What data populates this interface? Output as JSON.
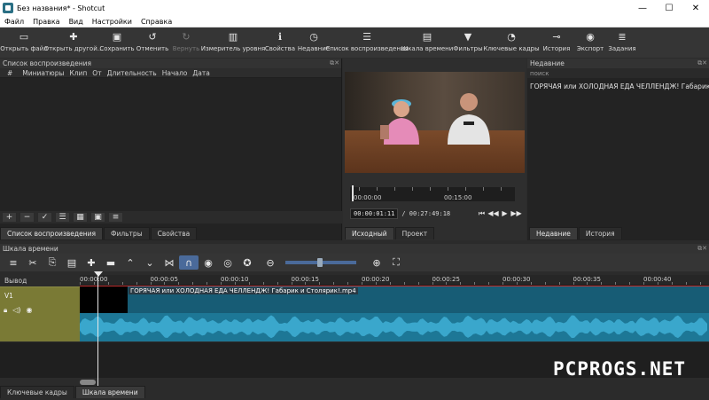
{
  "window": {
    "title": "Без названия* - Shotcut",
    "minimize": "—",
    "maximize": "☐",
    "close": "✕"
  },
  "menu": [
    "Файл",
    "Правка",
    "Вид",
    "Настройки",
    "Справка"
  ],
  "toolbar": [
    {
      "label": "Открыть файл",
      "icon": "folder-icon",
      "glyph": "▭"
    },
    {
      "label": "Открыть другой...",
      "icon": "open-other-icon",
      "glyph": "✚"
    },
    {
      "label": "Сохранить",
      "icon": "save-icon",
      "glyph": "▣"
    },
    {
      "label": "Отменить",
      "icon": "undo-icon",
      "glyph": "↺"
    },
    {
      "label": "Вернуть",
      "icon": "redo-icon",
      "glyph": "↻",
      "disabled": true
    },
    {
      "label": "Измеритель уровня",
      "icon": "level-meter-icon",
      "glyph": "▥"
    },
    {
      "label": "Свойства",
      "icon": "info-icon",
      "glyph": "ℹ"
    },
    {
      "label": "Недавние",
      "icon": "clock-icon",
      "glyph": "◷"
    },
    {
      "label": "Список воспроизведения",
      "icon": "playlist-icon",
      "glyph": "☰"
    },
    {
      "label": "Шкала времени",
      "icon": "timeline-icon",
      "glyph": "▤"
    },
    {
      "label": "Фильтры",
      "icon": "filter-icon",
      "glyph": "▼"
    },
    {
      "label": "Ключевые кадры",
      "icon": "stopwatch-icon",
      "glyph": "◔"
    },
    {
      "label": "История",
      "icon": "history-icon",
      "glyph": "⊸"
    },
    {
      "label": "Экспорт",
      "icon": "export-disc-icon",
      "glyph": "◉"
    },
    {
      "label": "Задания",
      "icon": "jobs-icon",
      "glyph": "≣"
    }
  ],
  "playlist": {
    "title": "Список воспроизведения",
    "columns": [
      "#",
      "Миниатюры",
      "Клип",
      "От",
      "Длительность",
      "Начало",
      "Дата"
    ],
    "tabs": [
      "Список воспроизведения",
      "Фильтры",
      "Свойства"
    ]
  },
  "player": {
    "ruler_labels": [
      "00:00:00",
      "00:15:00"
    ],
    "current_time": "00:00:01:11",
    "total_time": "/ 00:27:49:18",
    "tabs": [
      "Исходный",
      "Проект"
    ]
  },
  "recent": {
    "title": "Недавние",
    "search_placeholder": "поиск",
    "items": [
      "ГОРЯЧАЯ или ХОЛОДНАЯ ЕДА ЧЕЛЛЕНДЖ! Габарик и ..."
    ],
    "tabs": [
      "Недавние",
      "История"
    ]
  },
  "timeline": {
    "title": "Шкала времени",
    "output_label": "Вывод",
    "track_name": "V1",
    "ruler": [
      "00:00:00",
      "00:00:05",
      "00:00:10",
      "00:00:15",
      "00:00:20",
      "00:00:25",
      "00:00:30",
      "00:00:35",
      "00:00:40"
    ],
    "clip_name": "ГОРЯЧАЯ или ХОЛОДНАЯ ЕДА ЧЕЛЛЕНДЖ! Габарик и Столярик!.mp4",
    "bottom_tabs": [
      "Ключевые кадры",
      "Шкала времени"
    ]
  },
  "watermark": "PCPROGS.NET",
  "colors": {
    "clip": "#1d7796",
    "track_head": "#7a7a35",
    "accent": "#4a6a9a"
  }
}
